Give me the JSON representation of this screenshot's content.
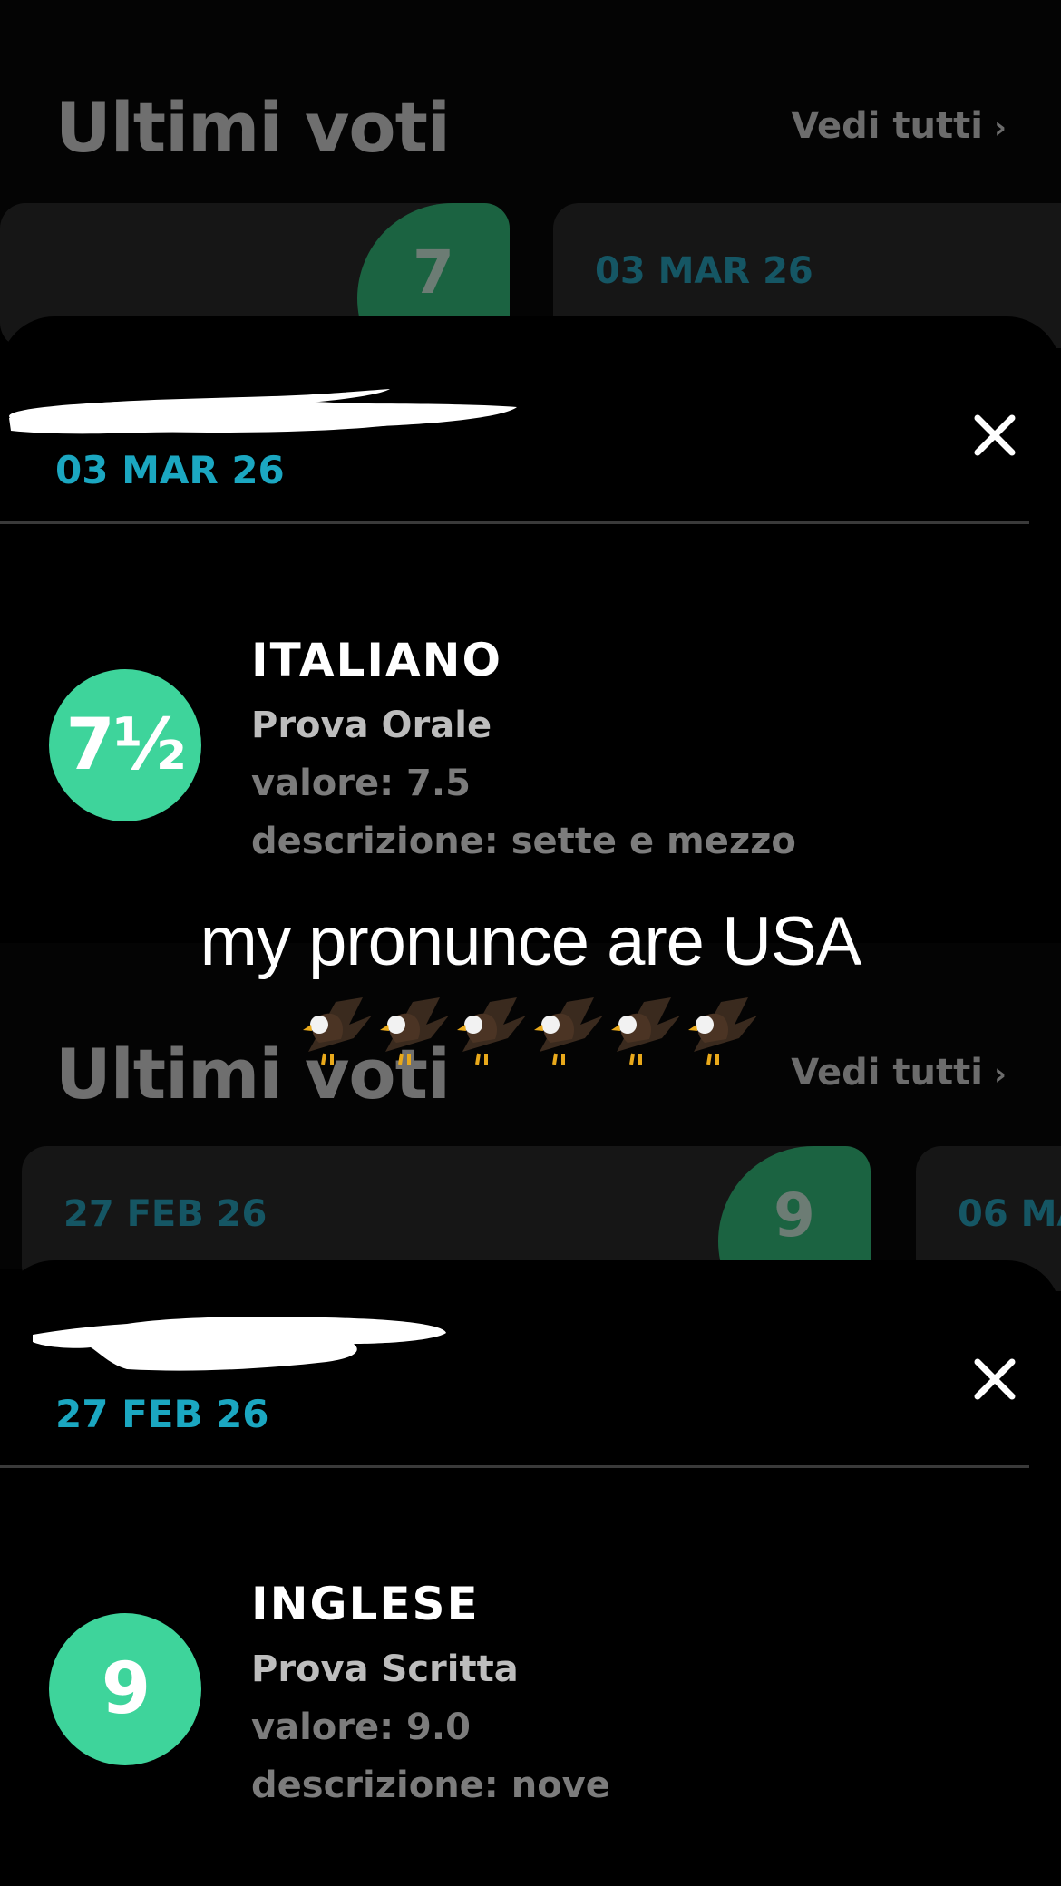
{
  "top": {
    "background": {
      "title": "Ultimi voti",
      "see_all": "Vedi tutti",
      "card_left_grade": "7",
      "card_right_date": "03 MAR 26"
    },
    "sheet": {
      "date": "03 MAR 26",
      "grade_display": "7½",
      "subject": "ITALIANO",
      "type": "Prova Orale",
      "value": "valore: 7.5",
      "description": "descrizione: sette e mezzo"
    }
  },
  "bottom": {
    "background": {
      "title": "Ultimi voti",
      "see_all": "Vedi tutti",
      "card_left_date": "27 FEB 26",
      "card_left_grade": "9",
      "card_right_date": "06 MA"
    },
    "sheet": {
      "date": "27 FEB 26",
      "grade_display": "9",
      "subject": "INGLESE",
      "type": "Prova Scritta",
      "value": "valore: 9.0",
      "description": "descrizione: nove"
    }
  },
  "caption": {
    "text": "my pronunce are USA",
    "emoji_icon": "eagle-icon",
    "emoji_count": 6
  },
  "colors": {
    "accent_date": "#1ba7c1",
    "grade_green": "#3ed49b",
    "grade_dim": "#1b6341"
  }
}
